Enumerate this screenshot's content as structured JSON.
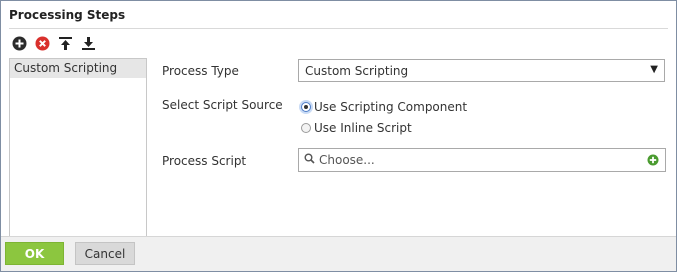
{
  "header": {
    "title": "Processing Steps"
  },
  "toolbar": {
    "icons": [
      "add-icon",
      "delete-icon",
      "move-to-top-icon",
      "move-to-bottom-icon"
    ]
  },
  "steps": {
    "items": [
      {
        "label": "Custom Scripting",
        "selected": true
      }
    ]
  },
  "form": {
    "process_type_label": "Process Type",
    "process_type_value": "Custom Scripting",
    "script_source_label": "Select Script Source",
    "radio_component_label": "Use Scripting Component",
    "radio_inline_label": "Use Inline Script",
    "selected_source": "Use Scripting Component",
    "process_script_label": "Process Script",
    "process_script_placeholder": "Choose..."
  },
  "footer": {
    "ok_label": "OK",
    "cancel_label": "Cancel"
  },
  "colors": {
    "ok_button": "#8cc63f",
    "cancel_button": "#d9d9d9",
    "add_icon": "#2b2b2b",
    "delete_icon": "#d9302c",
    "chooser_add_icon": "#4a9b2f"
  }
}
